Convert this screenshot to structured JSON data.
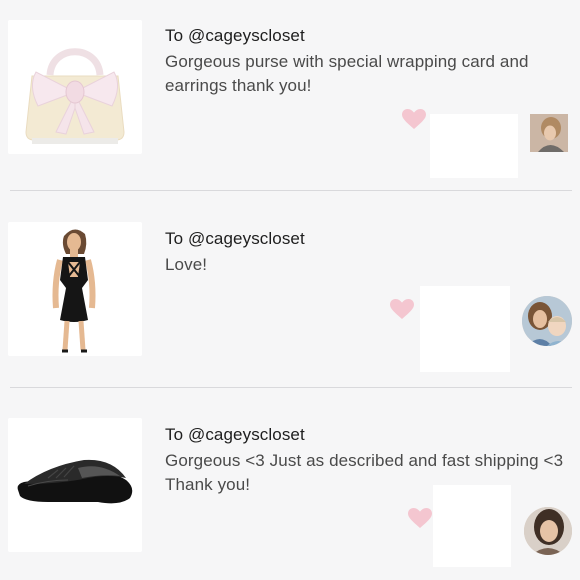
{
  "reviews": [
    {
      "recipient": "To @cageyscloset",
      "message": "Gorgeous purse with special wrapping card and earrings thank you!",
      "product_image": "purse-with-bow",
      "avatar_icon": "reviewer-avatar-1"
    },
    {
      "recipient": "To @cageyscloset",
      "message": "Love!",
      "product_image": "black-dress",
      "avatar_icon": "reviewer-avatar-2"
    },
    {
      "recipient": "To @cageyscloset",
      "message": "Gorgeous <3 Just as described and fast shipping <3 Thank you!",
      "product_image": "black-flat-shoe",
      "avatar_icon": "reviewer-avatar-3"
    }
  ],
  "colors": {
    "background": "#f6f6f7",
    "heart": "#f4c6d0",
    "divider": "#d9d9dc",
    "text": "#4a4a4a"
  }
}
